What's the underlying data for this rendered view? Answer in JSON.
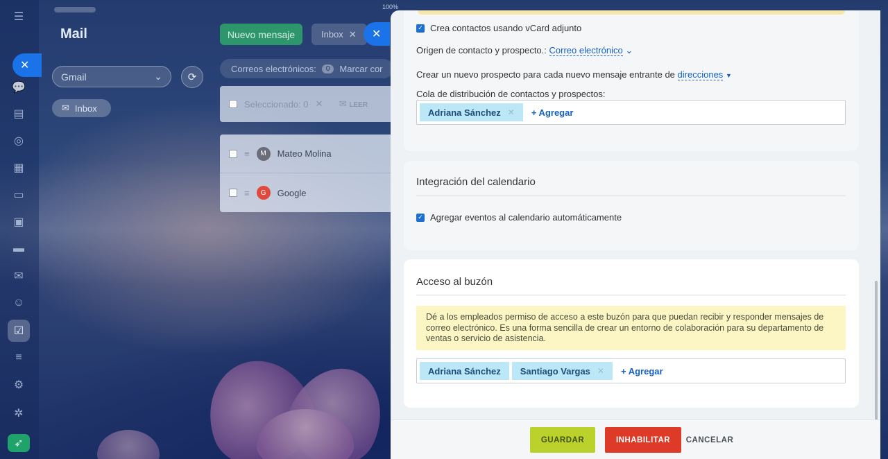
{
  "background": {
    "zoom": "100%"
  },
  "mail_app": {
    "title": "Mail",
    "account_select": "Gmail",
    "folder": "Inbox",
    "new_message": "Nuevo mensaje",
    "inbox_tab": "Inbox",
    "emails_label": "Correos electrónicos:",
    "emails_count": "0",
    "mark_label": "Marcar cor",
    "selected_label": "Seleccionado: 0",
    "read_label": "LEER",
    "rows": [
      {
        "sender": "Mateo Molina",
        "initial": "M"
      },
      {
        "sender": "Google",
        "initial": "G"
      }
    ]
  },
  "crm_section": {
    "vcard_label": "Crea contactos usando vCard adjunto",
    "source_label": "Origen de contacto y prospecto.:",
    "source_value": "Correo electrónico",
    "new_lead_label": "Crear un nuevo prospecto para cada nuevo mensaje entrante de",
    "new_lead_value": "direcciones",
    "queue_label": "Cola de distribución de contactos y prospectos:",
    "queue_tags": [
      "Adriana Sánchez"
    ],
    "add_label": "+ Agregar"
  },
  "calendar_section": {
    "title": "Integración del calendario",
    "auto_events_label": "Agregar eventos al calendario automáticamente"
  },
  "access_section": {
    "title": "Acceso al buzón",
    "notice": "Dé a los empleados permiso de acceso a este buzón para que puedan recibir y responder mensajes de correo electrónico. Es una forma sencilla de crear un entorno de colaboración para su departamento de ventas o servicio de asistencia.",
    "tags": [
      "Adriana Sánchez",
      "Santiago Vargas"
    ],
    "add_label": "+ Agregar"
  },
  "footer": {
    "save": "GUARDAR",
    "disable": "INHABILITAR",
    "cancel": "CANCELAR"
  },
  "colors": {
    "accent_blue": "#1a73e8",
    "save_green": "#bbd22c",
    "disable_red": "#dd3a28",
    "tag_blue": "#bce7f7",
    "notice_yellow": "#fcf6c4"
  }
}
